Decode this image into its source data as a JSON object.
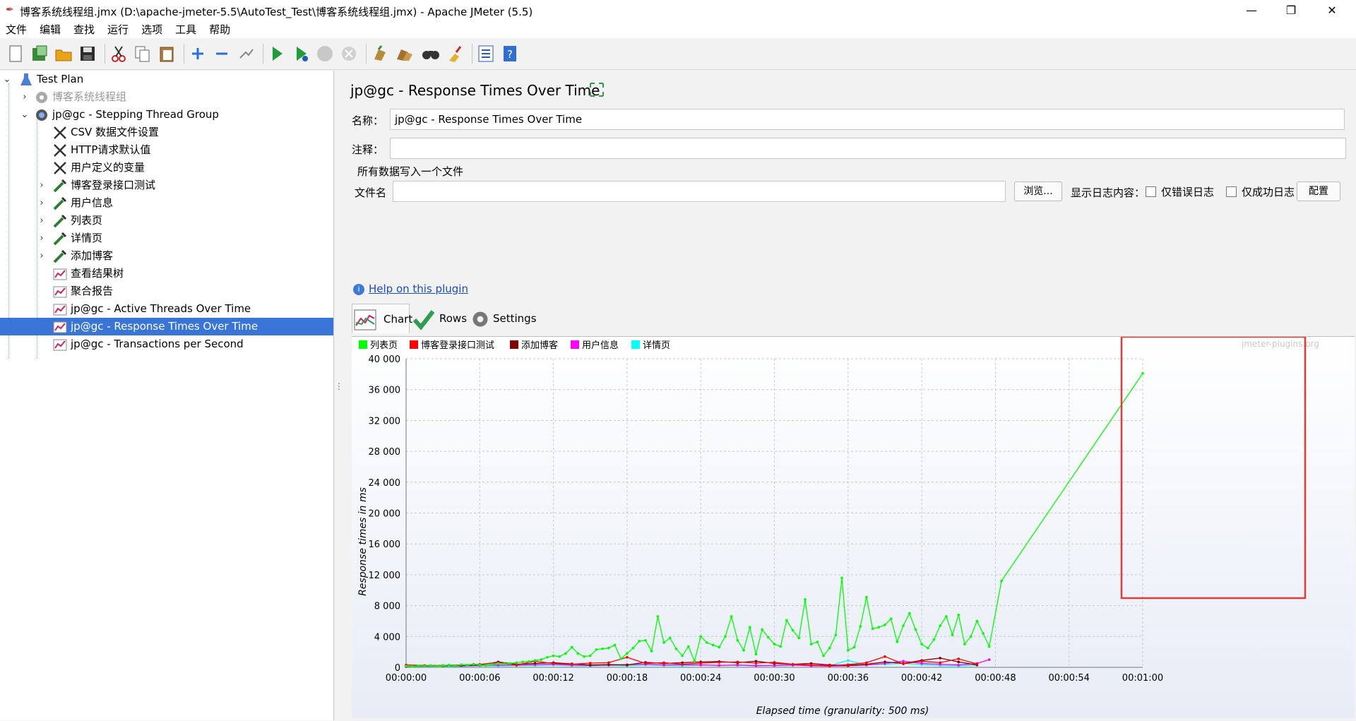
{
  "window": {
    "title": "博客系统线程组.jmx (D:\\apache-jmeter-5.5\\AutoTest_Test\\博客系统线程组.jmx) - Apache JMeter (5.5)",
    "controls": [
      "—",
      "❐",
      "✕"
    ]
  },
  "menu": [
    "文件",
    "编辑",
    "查找",
    "运行",
    "选项",
    "工具",
    "帮助"
  ],
  "toolbar_icons": [
    "new-icon",
    "templates-icon",
    "open-icon",
    "save-icon",
    "cut-icon",
    "copy-icon",
    "paste-icon",
    "expand-icon",
    "collapse-icon",
    "toggle-icon",
    "start-icon",
    "start-no-pause-icon",
    "stop-icon",
    "shutdown-icon",
    "clear-icon",
    "clear-all-icon",
    "search-icon",
    "reset-search-icon",
    "function-helper-icon",
    "help-icon"
  ],
  "tree": [
    {
      "label": "Test Plan",
      "icon": "flask-icon",
      "level": 0,
      "toggle": "open"
    },
    {
      "label": "博客系统线程组",
      "icon": "gear-icon",
      "level": 1,
      "toggle": "closed",
      "disabled": true
    },
    {
      "label": "jp@gc - Stepping Thread Group",
      "icon": "gear-icon",
      "level": 1,
      "toggle": "open"
    },
    {
      "label": "CSV 数据文件设置",
      "icon": "tools-icon",
      "level": 2
    },
    {
      "label": "HTTP请求默认值",
      "icon": "tools-icon",
      "level": 2
    },
    {
      "label": "用户定义的变量",
      "icon": "tools-icon",
      "level": 2
    },
    {
      "label": "博客登录接口测试",
      "icon": "pipette-icon",
      "level": 2,
      "toggle": "closed"
    },
    {
      "label": "用户信息",
      "icon": "pipette-icon",
      "level": 2,
      "toggle": "closed"
    },
    {
      "label": "列表页",
      "icon": "pipette-icon",
      "level": 2,
      "toggle": "closed"
    },
    {
      "label": "详情页",
      "icon": "pipette-icon",
      "level": 2,
      "toggle": "closed"
    },
    {
      "label": "添加博客",
      "icon": "pipette-icon",
      "level": 2,
      "toggle": "closed"
    },
    {
      "label": "查看结果树",
      "icon": "graph-icon",
      "level": 2
    },
    {
      "label": "聚合报告",
      "icon": "graph-icon",
      "level": 2
    },
    {
      "label": "jp@gc - Active Threads Over Time",
      "icon": "graph-icon",
      "level": 2
    },
    {
      "label": "jp@gc - Response Times Over Time",
      "icon": "graph-icon",
      "level": 2,
      "selected": true
    },
    {
      "label": "jp@gc - Transactions per Second",
      "icon": "graph-icon",
      "level": 2
    }
  ],
  "panel": {
    "title": "jp@gc - Response Times Over Time",
    "name_label": "名称：",
    "name_value": "jp@gc - Response Times Over Time",
    "comment_label": "注释：",
    "comment_value": "",
    "section_label": "所有数据写入一个文件",
    "filename_label": "文件名",
    "filename_value": "",
    "browse_label": "浏览...",
    "log_label": "显示日志内容：",
    "errors_only_label": "仅错误日志",
    "success_only_label": "仅成功日志",
    "config_label": "配置",
    "help_link": "Help on this plugin",
    "tabs": [
      "Chart",
      "Rows",
      "Settings"
    ]
  },
  "colors": {
    "selection": "#3875d7",
    "highlight_box": "#e53935",
    "chart_bg_bottom": "#e7ecf6"
  },
  "chart_data": {
    "type": "line",
    "xlabel": "Elapsed time (granularity: 500 ms)",
    "ylabel": "Response times in ms",
    "watermark": "jmeter-plugins.org",
    "xlim_seconds": [
      0,
      60
    ],
    "ylim": [
      0,
      40000
    ],
    "x_ticks": [
      "00:00:00",
      "00:00:06",
      "00:00:12",
      "00:00:18",
      "00:00:24",
      "00:00:30",
      "00:00:36",
      "00:00:42",
      "00:00:48",
      "00:00:54",
      "00:01:00"
    ],
    "y_ticks": [
      "0",
      "4 000",
      "8 000",
      "12 000",
      "16 000",
      "20 000",
      "24 000",
      "28 000",
      "32 000",
      "36 000",
      "40 000"
    ],
    "grid": true,
    "legend_position": "top-left",
    "series": [
      {
        "name": "列表页",
        "color": "#00ff00",
        "points": [
          [
            0,
            150
          ],
          [
            0.5,
            120
          ],
          [
            1,
            200
          ],
          [
            1.5,
            180
          ],
          [
            2,
            250
          ],
          [
            2.5,
            160
          ],
          [
            3,
            230
          ],
          [
            3.5,
            300
          ],
          [
            4,
            200
          ],
          [
            4.5,
            350
          ],
          [
            5,
            280
          ],
          [
            5.5,
            420
          ],
          [
            6,
            300
          ],
          [
            6.5,
            250
          ],
          [
            7,
            380
          ],
          [
            7.5,
            500
          ],
          [
            8,
            450
          ],
          [
            8.5,
            520
          ],
          [
            9,
            600
          ],
          [
            9.5,
            700
          ],
          [
            10,
            750
          ],
          [
            10.5,
            900
          ],
          [
            11,
            1000
          ],
          [
            11.5,
            1300
          ],
          [
            12,
            1500
          ],
          [
            12.5,
            1400
          ],
          [
            13,
            1800
          ],
          [
            13.5,
            2600
          ],
          [
            14,
            1800
          ],
          [
            14.5,
            1400
          ],
          [
            15,
            1500
          ],
          [
            15.5,
            2300
          ],
          [
            16,
            2400
          ],
          [
            16.5,
            2500
          ],
          [
            17,
            2900
          ],
          [
            17.5,
            1100
          ],
          [
            18,
            1800
          ],
          [
            18.5,
            2500
          ],
          [
            19,
            3400
          ],
          [
            19.5,
            3500
          ],
          [
            20,
            2100
          ],
          [
            20.5,
            6600
          ],
          [
            21,
            3200
          ],
          [
            21.5,
            3800
          ],
          [
            22,
            2400
          ],
          [
            22.5,
            1500
          ],
          [
            23,
            2700
          ],
          [
            23.5,
            800
          ],
          [
            24,
            4000
          ],
          [
            24.5,
            3200
          ],
          [
            25,
            2900
          ],
          [
            25.5,
            2600
          ],
          [
            26,
            4000
          ],
          [
            26.5,
            6600
          ],
          [
            27,
            3500
          ],
          [
            27.5,
            2200
          ],
          [
            28,
            5200
          ],
          [
            28.5,
            1700
          ],
          [
            29,
            4900
          ],
          [
            29.5,
            3900
          ],
          [
            30,
            3000
          ],
          [
            30.5,
            2700
          ],
          [
            31,
            6100
          ],
          [
            31.5,
            4800
          ],
          [
            32,
            3800
          ],
          [
            32.5,
            8800
          ],
          [
            33,
            3000
          ],
          [
            33.5,
            3300
          ],
          [
            34,
            1500
          ],
          [
            34.5,
            2500
          ],
          [
            35,
            4200
          ],
          [
            35.5,
            11600
          ],
          [
            36,
            2200
          ],
          [
            36.5,
            2600
          ],
          [
            37,
            5300
          ],
          [
            37.5,
            9100
          ],
          [
            38,
            5000
          ],
          [
            38.5,
            5200
          ],
          [
            39,
            5500
          ],
          [
            39.5,
            6300
          ],
          [
            40,
            3300
          ],
          [
            40.5,
            5400
          ],
          [
            41,
            7000
          ],
          [
            41.5,
            4900
          ],
          [
            42,
            3000
          ],
          [
            42.5,
            2500
          ],
          [
            43,
            3600
          ],
          [
            43.5,
            5400
          ],
          [
            44,
            6600
          ],
          [
            44.5,
            4200
          ],
          [
            45,
            6800
          ],
          [
            45.5,
            3000
          ],
          [
            46,
            4000
          ],
          [
            46.5,
            6000
          ],
          [
            47,
            4400
          ],
          [
            47.5,
            2700
          ],
          [
            48.5,
            11200
          ],
          [
            60,
            38100
          ]
        ]
      },
      {
        "name": "博客登录接口测试",
        "color": "#ff0000",
        "points": [
          [
            0,
            300
          ],
          [
            1.5,
            250
          ],
          [
            3,
            250
          ],
          [
            4.5,
            320
          ],
          [
            6,
            380
          ],
          [
            7.5,
            600
          ],
          [
            9,
            300
          ],
          [
            10.5,
            800
          ],
          [
            12,
            500
          ],
          [
            13.5,
            400
          ],
          [
            15,
            550
          ],
          [
            16.5,
            600
          ],
          [
            18,
            1300
          ],
          [
            19.5,
            500
          ],
          [
            21,
            600
          ],
          [
            22.5,
            400
          ],
          [
            24,
            550
          ],
          [
            25.5,
            650
          ],
          [
            27,
            700
          ],
          [
            28.5,
            550
          ],
          [
            30,
            650
          ],
          [
            31.5,
            400
          ],
          [
            33,
            300
          ],
          [
            34.5,
            200
          ],
          [
            36,
            350
          ],
          [
            37.5,
            600
          ],
          [
            39,
            1400
          ],
          [
            40.5,
            450
          ],
          [
            42,
            800
          ],
          [
            43.5,
            600
          ],
          [
            45,
            1100
          ],
          [
            46.5,
            450
          ]
        ]
      },
      {
        "name": "添加博客",
        "color": "#800000",
        "points": [
          [
            0,
            100
          ],
          [
            1.5,
            200
          ],
          [
            3,
            180
          ],
          [
            4.5,
            250
          ],
          [
            6,
            300
          ],
          [
            7.5,
            700
          ],
          [
            9,
            400
          ],
          [
            10.5,
            500
          ],
          [
            12,
            600
          ],
          [
            13.5,
            450
          ],
          [
            15,
            300
          ],
          [
            16.5,
            350
          ],
          [
            18,
            300
          ],
          [
            19.5,
            650
          ],
          [
            21,
            500
          ],
          [
            22.5,
            600
          ],
          [
            24,
            700
          ],
          [
            25.5,
            750
          ],
          [
            27,
            600
          ],
          [
            28.5,
            800
          ],
          [
            30,
            500
          ],
          [
            31.5,
            400
          ],
          [
            33,
            500
          ],
          [
            34.5,
            300
          ],
          [
            36,
            250
          ],
          [
            37.5,
            400
          ],
          [
            39,
            700
          ],
          [
            40.5,
            500
          ],
          [
            42,
            900
          ],
          [
            43.5,
            1200
          ],
          [
            45,
            700
          ],
          [
            46.5,
            300
          ]
        ]
      },
      {
        "name": "用户信息",
        "color": "#ff00ff",
        "points": [
          [
            0,
            120
          ],
          [
            1.5,
            150
          ],
          [
            3,
            200
          ],
          [
            4.5,
            180
          ],
          [
            6,
            250
          ],
          [
            7.5,
            300
          ],
          [
            9,
            280
          ],
          [
            10.5,
            350
          ],
          [
            12,
            400
          ],
          [
            13.5,
            300
          ],
          [
            15,
            250
          ],
          [
            16.5,
            300
          ],
          [
            18,
            350
          ],
          [
            19.5,
            400
          ],
          [
            21,
            300
          ],
          [
            22.5,
            350
          ],
          [
            24,
            300
          ],
          [
            25.5,
            250
          ],
          [
            27,
            300
          ],
          [
            28.5,
            200
          ],
          [
            30,
            250
          ],
          [
            31.5,
            300
          ],
          [
            33,
            200
          ],
          [
            34.5,
            150
          ],
          [
            36,
            200
          ],
          [
            37.5,
            300
          ],
          [
            39,
            500
          ],
          [
            40.5,
            800
          ],
          [
            42,
            500
          ],
          [
            43.5,
            400
          ],
          [
            45,
            300
          ],
          [
            46.5,
            500
          ],
          [
            47.5,
            1000
          ]
        ]
      },
      {
        "name": "详情页",
        "color": "#00ffff",
        "points": [
          [
            0,
            80
          ],
          [
            1.5,
            100
          ],
          [
            3,
            150
          ],
          [
            4.5,
            120
          ],
          [
            6,
            200
          ],
          [
            7.5,
            180
          ],
          [
            9,
            220
          ],
          [
            10.5,
            250
          ],
          [
            12,
            300
          ],
          [
            13.5,
            200
          ],
          [
            15,
            180
          ],
          [
            16.5,
            250
          ],
          [
            18,
            200
          ],
          [
            19.5,
            300
          ],
          [
            21,
            250
          ],
          [
            22.5,
            200
          ],
          [
            24,
            300
          ],
          [
            25.5,
            280
          ],
          [
            27,
            250
          ],
          [
            28.5,
            300
          ],
          [
            30,
            200
          ],
          [
            31.5,
            250
          ],
          [
            33,
            300
          ],
          [
            34.5,
            200
          ],
          [
            36,
            900
          ],
          [
            37.5,
            300
          ],
          [
            39,
            400
          ],
          [
            40.5,
            500
          ],
          [
            42,
            350
          ],
          [
            43.5,
            250
          ],
          [
            45,
            200
          ],
          [
            46.5,
            300
          ]
        ]
      }
    ]
  }
}
